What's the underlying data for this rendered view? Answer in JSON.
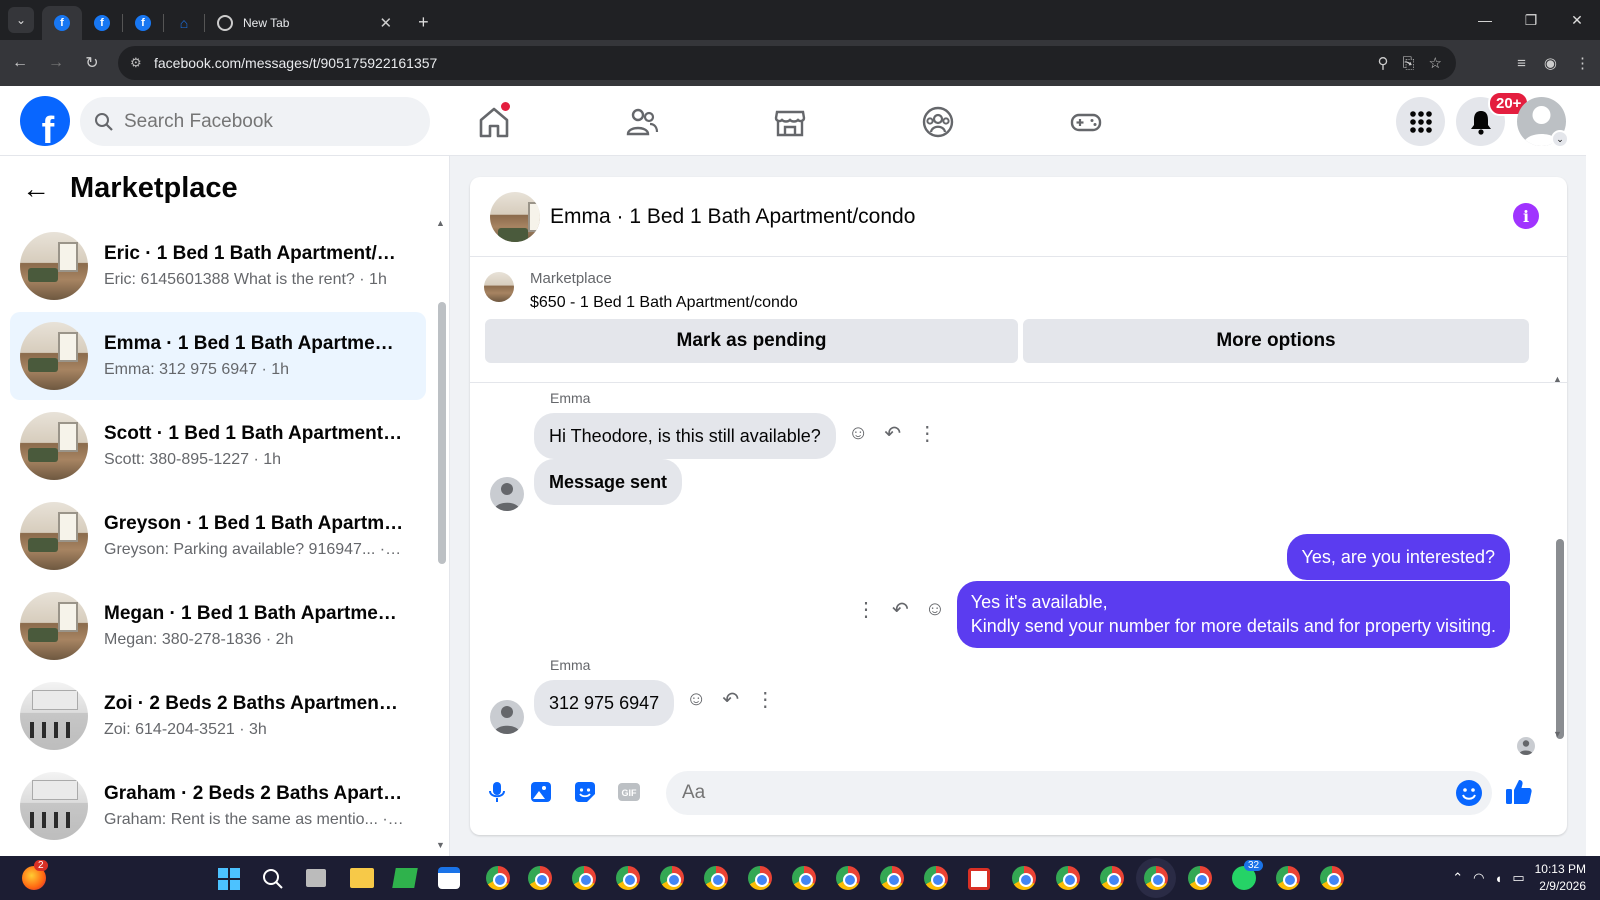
{
  "browser": {
    "tabs": [
      {
        "label": ""
      },
      {
        "label": ""
      },
      {
        "label": ""
      },
      {
        "label": ""
      },
      {
        "label": "New Tab"
      }
    ],
    "url": "facebook.com/messages/t/905175922161357"
  },
  "header": {
    "logo": "f",
    "search_placeholder": "Search Facebook",
    "notification_badge": "20+"
  },
  "sidebar": {
    "title": "Marketplace",
    "conversations": [
      {
        "name": "Eric · 1 Bed 1 Bath Apartment/co...",
        "preview": "Eric: 6145601388 What is the rent? · 1h",
        "thumb": "apt"
      },
      {
        "name": "Emma · 1 Bed 1 Bath Apartment/...",
        "preview": "Emma: 312 975 6947 · 1h",
        "thumb": "apt",
        "active": true
      },
      {
        "name": "Scott · 1 Bed 1 Bath Apartment/c...",
        "preview": "Scott: 380-895-1227 · 1h",
        "thumb": "apt"
      },
      {
        "name": "Greyson · 1 Bed 1 Bath Apartmen...",
        "preview": "Greyson: Parking available? 916947... · 2h",
        "thumb": "apt"
      },
      {
        "name": "Megan · 1 Bed 1 Bath Apartment...",
        "preview": "Megan: 380-278-1836 · 2h",
        "thumb": "apt"
      },
      {
        "name": "Zoi · 2 Beds 2 Baths Apartment/c...",
        "preview": "Zoi: 614-204-3521 · 3h",
        "thumb": "kit"
      },
      {
        "name": "Graham · 2 Beds 2 Baths Apartm...",
        "preview": "Graham: Rent is the same as mentio... · 5h",
        "thumb": "kit"
      }
    ]
  },
  "chat": {
    "title": "Emma · 1 Bed 1 Bath Apartment/condo",
    "listing_label": "Marketplace",
    "listing_title": "$650 - 1 Bed 1 Bath Apartment/condo",
    "mark_pending": "Mark as pending",
    "more_options": "More options",
    "sender_name": "Emma",
    "messages": [
      {
        "text": "Hi Theodore, is this still available?",
        "dir": "in"
      },
      {
        "text": "Message sent",
        "dir": "in"
      },
      {
        "text": "Yes, are you interested?",
        "dir": "out"
      },
      {
        "text": "Yes it's available,",
        "text2": "Kindly send your number for more details and for property visiting.",
        "dir": "out"
      },
      {
        "text": "312 975 6947",
        "dir": "in"
      }
    ],
    "composer_placeholder": "Aa"
  },
  "colors": {
    "facebook_blue": "#0866ff",
    "outgoing_bubble": "#5b3cf0",
    "info_purple": "#a033ff",
    "badge_red": "#e41e3f"
  },
  "taskbar": {
    "time": "10:13 PM",
    "date": "2/9/2026",
    "whatsapp_badge": "32",
    "firefox_badge": "2"
  }
}
